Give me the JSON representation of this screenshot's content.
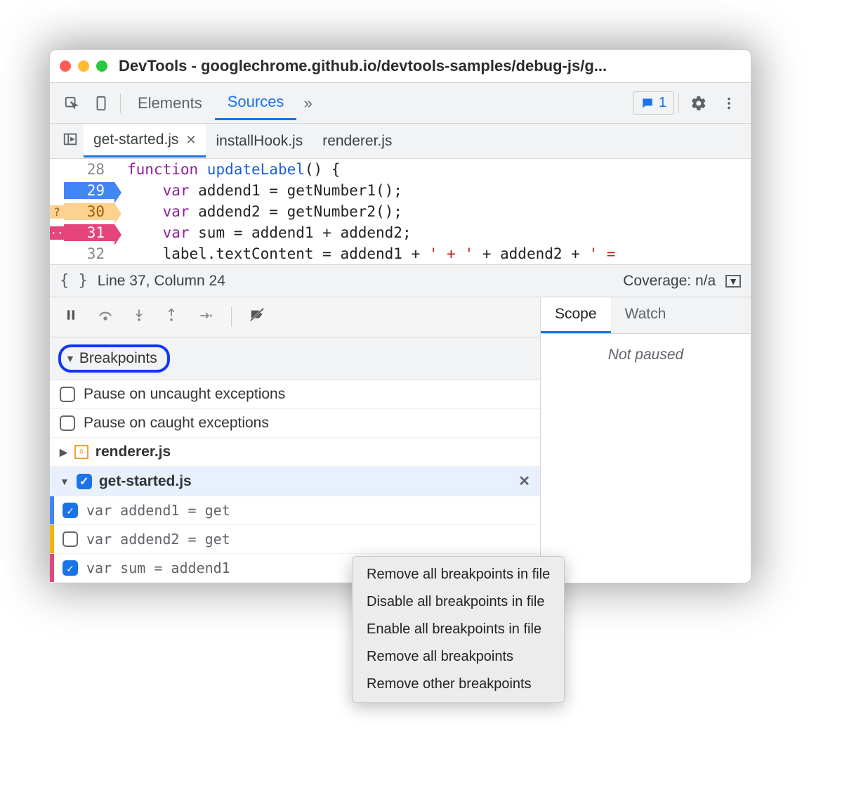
{
  "window": {
    "title": "DevTools - googlechrome.github.io/devtools-samples/debug-js/g..."
  },
  "toolbar": {
    "tab_elements": "Elements",
    "tab_sources": "Sources",
    "feedback_count": "1"
  },
  "file_tabs": {
    "t0": "get-started.js",
    "t1": "installHook.js",
    "t2": "renderer.js"
  },
  "code": {
    "ln28": "28",
    "c28a": "function ",
    "c28b": "updateLabel",
    "c28c": "() {",
    "ln29": "29",
    "c29a": "var ",
    "c29b": "addend1 = getNumber1();",
    "ln30": "30",
    "pm30": "?",
    "c30a": "var ",
    "c30b": "addend2 = getNumber2();",
    "ln31": "31",
    "pm31": "··",
    "c31a": "var ",
    "c31b": "sum = addend1 + addend2;",
    "ln32": "32",
    "c32a": "label.textContent = addend1 + ",
    "c32b": "' + '",
    "c32c": " + addend2 + ",
    "c32d": "' ="
  },
  "status": {
    "pos": "Line 37, Column 24",
    "coverage": "Coverage: n/a"
  },
  "breakpoints": {
    "header": "Breakpoints",
    "pause_uncaught": "Pause on uncaught exceptions",
    "pause_caught": "Pause on caught exceptions",
    "group_renderer": "renderer.js",
    "group_started": "get-started.js",
    "item1": "var addend1 = get",
    "item2": "var addend2 = get",
    "item3": "var sum = addend1"
  },
  "right": {
    "tab_scope": "Scope",
    "tab_watch": "Watch",
    "not_paused": "Not paused"
  },
  "context_menu": {
    "m0": "Remove all breakpoints in file",
    "m1": "Disable all breakpoints in file",
    "m2": "Enable all breakpoints in file",
    "m3": "Remove all breakpoints",
    "m4": "Remove other breakpoints"
  }
}
